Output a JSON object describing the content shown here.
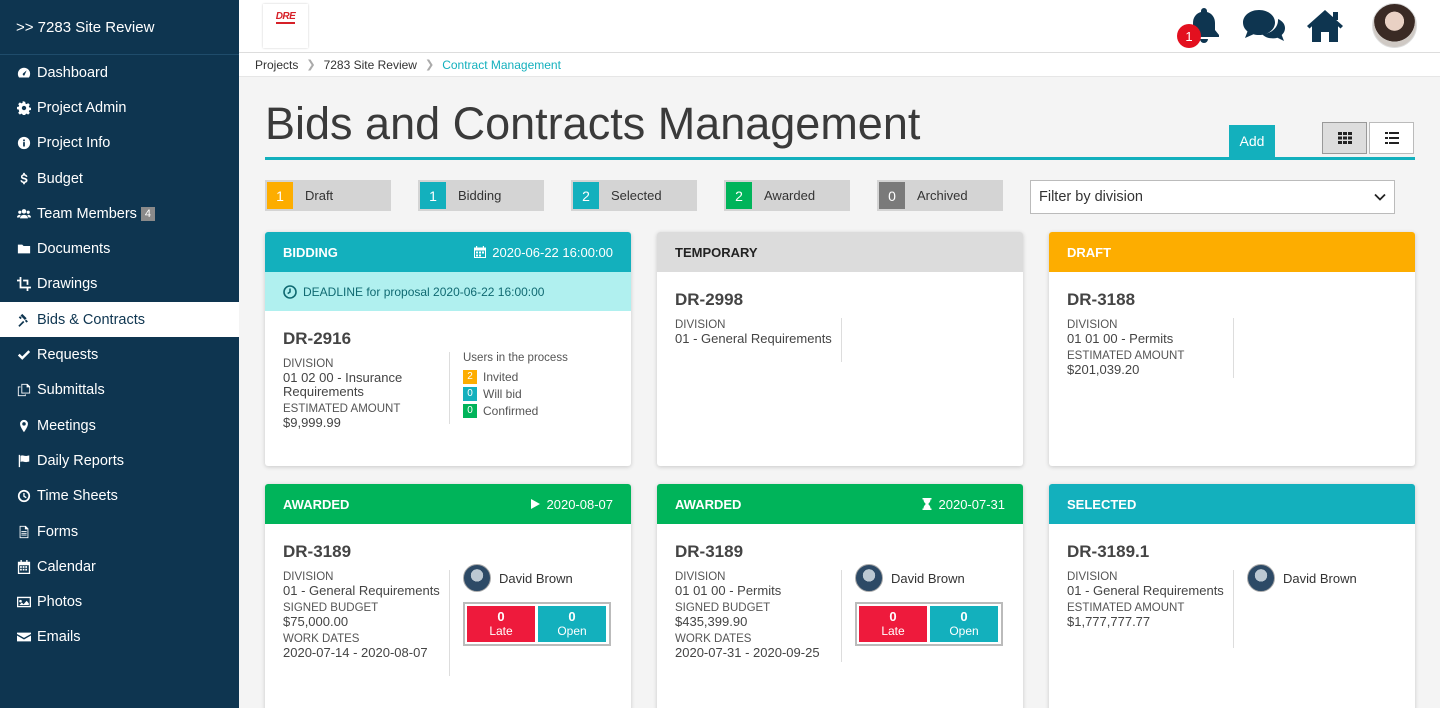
{
  "sidebar": {
    "title": ">> 7283 Site Review",
    "items": [
      {
        "label": "Dashboard",
        "icon": "dashboard-icon"
      },
      {
        "label": "Project Admin",
        "icon": "gear-icon"
      },
      {
        "label": "Project Info",
        "icon": "info-icon"
      },
      {
        "label": "Budget",
        "icon": "dollar-icon"
      },
      {
        "label": "Team Members",
        "icon": "users-icon",
        "badge": "4"
      },
      {
        "label": "Documents",
        "icon": "folder-icon"
      },
      {
        "label": "Drawings",
        "icon": "crop-icon"
      },
      {
        "label": "Bids & Contracts",
        "icon": "gavel-icon",
        "active": true
      },
      {
        "label": "Requests",
        "icon": "check-icon"
      },
      {
        "label": "Submittals",
        "icon": "copy-icon"
      },
      {
        "label": "Meetings",
        "icon": "map-marker-icon"
      },
      {
        "label": "Daily Reports",
        "icon": "flag-icon"
      },
      {
        "label": "Time Sheets",
        "icon": "clock-icon"
      },
      {
        "label": "Forms",
        "icon": "file-icon"
      },
      {
        "label": "Calendar",
        "icon": "calendar-icon"
      },
      {
        "label": "Photos",
        "icon": "image-icon"
      },
      {
        "label": "Emails",
        "icon": "envelope-icon"
      }
    ]
  },
  "topbar": {
    "logo_text": "DRE",
    "notification_count": "1"
  },
  "breadcrumb": [
    "Projects",
    "7283 Site Review",
    "Contract Management"
  ],
  "page": {
    "title": "Bids and Contracts Management",
    "add_label": "Add"
  },
  "statuses": [
    {
      "count": "1",
      "label": "Draft",
      "color": "#fdad00"
    },
    {
      "count": "1",
      "label": "Bidding",
      "color": "#13b0bd"
    },
    {
      "count": "2",
      "label": "Selected",
      "color": "#13b0bd"
    },
    {
      "count": "2",
      "label": "Awarded",
      "color": "#00b45a"
    },
    {
      "count": "0",
      "label": "Archived",
      "color": "#7a7a7a"
    }
  ],
  "filter": {
    "selected": "Filter by division"
  },
  "cards": [
    {
      "status": "BIDDING",
      "date": "2020-06-22 16:00:00",
      "deadline": "DEADLINE for proposal 2020-06-22 16:00:00",
      "id": "DR-2916",
      "division_label": "DIVISION",
      "division": "01 02 00 - Insurance Requirements",
      "amount_label": "ESTIMATED AMOUNT",
      "amount": "$9,999.99",
      "users_title": "Users in the process",
      "users": [
        {
          "count": "2",
          "label": "Invited",
          "color": "#fdad00"
        },
        {
          "count": "0",
          "label": "Will bid",
          "color": "#13b0bd"
        },
        {
          "count": "0",
          "label": "Confirmed",
          "color": "#00b45a"
        }
      ]
    },
    {
      "status": "TEMPORARY",
      "id": "DR-2998",
      "division_label": "DIVISION",
      "division": "01 - General Requirements"
    },
    {
      "status": "DRAFT",
      "id": "DR-3188",
      "division_label": "DIVISION",
      "division": "01 01 00 - Permits",
      "amount_label": "ESTIMATED AMOUNT",
      "amount": "$201,039.20"
    },
    {
      "status": "AWARDED",
      "date": "2020-08-07",
      "id": "DR-3189",
      "division_label": "DIVISION",
      "division": "01 - General Requirements",
      "budget_label": "SIGNED BUDGET",
      "budget": "$75,000.00",
      "dates_label": "WORK DATES",
      "dates": "2020-07-14 - 2020-08-07",
      "person": "David Brown",
      "late": "0",
      "late_label": "Late",
      "open": "0",
      "open_label": "Open"
    },
    {
      "status": "AWARDED",
      "date": "2020-07-31",
      "id": "DR-3189",
      "division_label": "DIVISION",
      "division": "01 01 00 - Permits",
      "budget_label": "SIGNED BUDGET",
      "budget": "$435,399.90",
      "dates_label": "WORK DATES",
      "dates": "2020-07-31 - 2020-09-25",
      "person": "David Brown",
      "late": "0",
      "late_label": "Late",
      "open": "0",
      "open_label": "Open"
    },
    {
      "status": "SELECTED",
      "id": "DR-3189.1",
      "division_label": "DIVISION",
      "division": "01 - General Requirements",
      "amount_label": "ESTIMATED AMOUNT",
      "amount": "$1,777,777.77",
      "person": "David Brown"
    }
  ]
}
